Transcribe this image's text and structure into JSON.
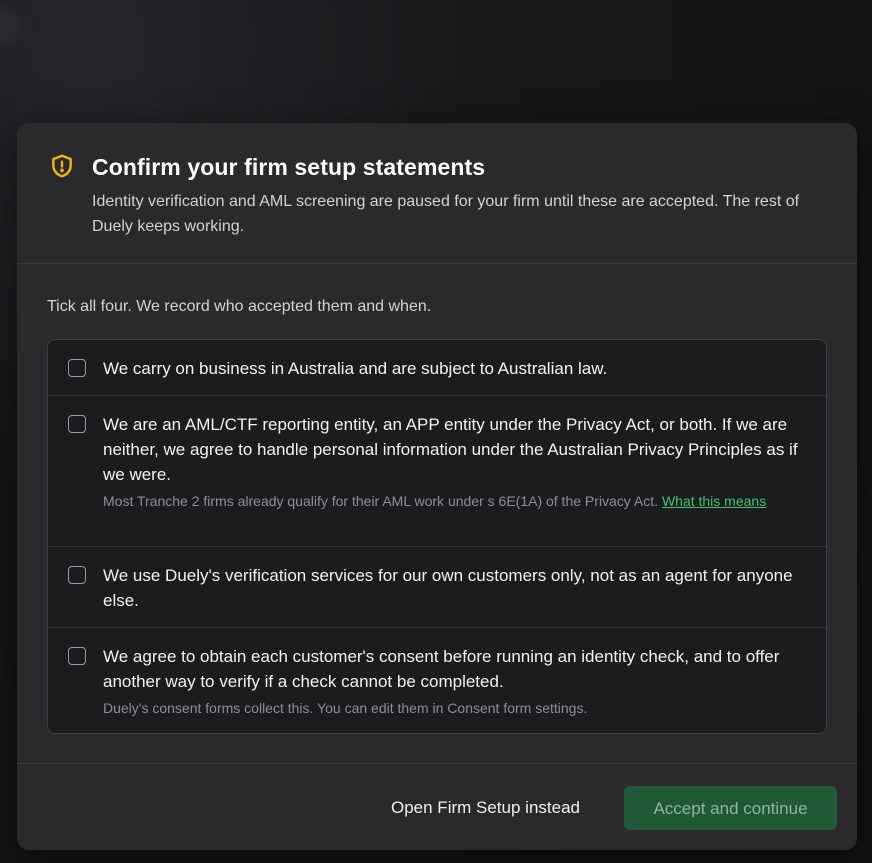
{
  "dialog": {
    "icon": "shield-alert-icon",
    "title": "Confirm your firm setup statements",
    "subtitle": "Identity verification and AML screening are paused for your firm until these are accepted. The rest of Duely keeps working.",
    "instruction": "Tick all four. We record who accepted them and when."
  },
  "statements": [
    {
      "text": "We carry on business in Australia and are subject to Australian law.",
      "checked": false
    },
    {
      "text": "We are an AML/CTF reporting entity, an APP entity under the Privacy Act, or both. If we are neither, we agree to handle personal information under the Australian Privacy Principles as if we were.",
      "note": "Most Tranche 2 firms already qualify for their AML work under s 6E(1A) of the Privacy Act.",
      "link": "What this means",
      "checked": false
    },
    {
      "text": "We use Duely's verification services for our own customers only, not as an agent for anyone else.",
      "checked": false
    },
    {
      "text": "We agree to obtain each customer's consent before running an identity check, and to offer another way to verify if a check cannot be completed.",
      "note": "Duely's consent forms collect this. You can edit them in Consent form settings.",
      "checked": false
    }
  ],
  "footer": {
    "secondary_label": "Open Firm Setup instead",
    "primary_label": "Accept and continue",
    "primary_disabled": true
  },
  "colors": {
    "accent_warning": "#f5b800",
    "link": "#3ec46d",
    "primary_button_bg": "#1d5a35"
  }
}
